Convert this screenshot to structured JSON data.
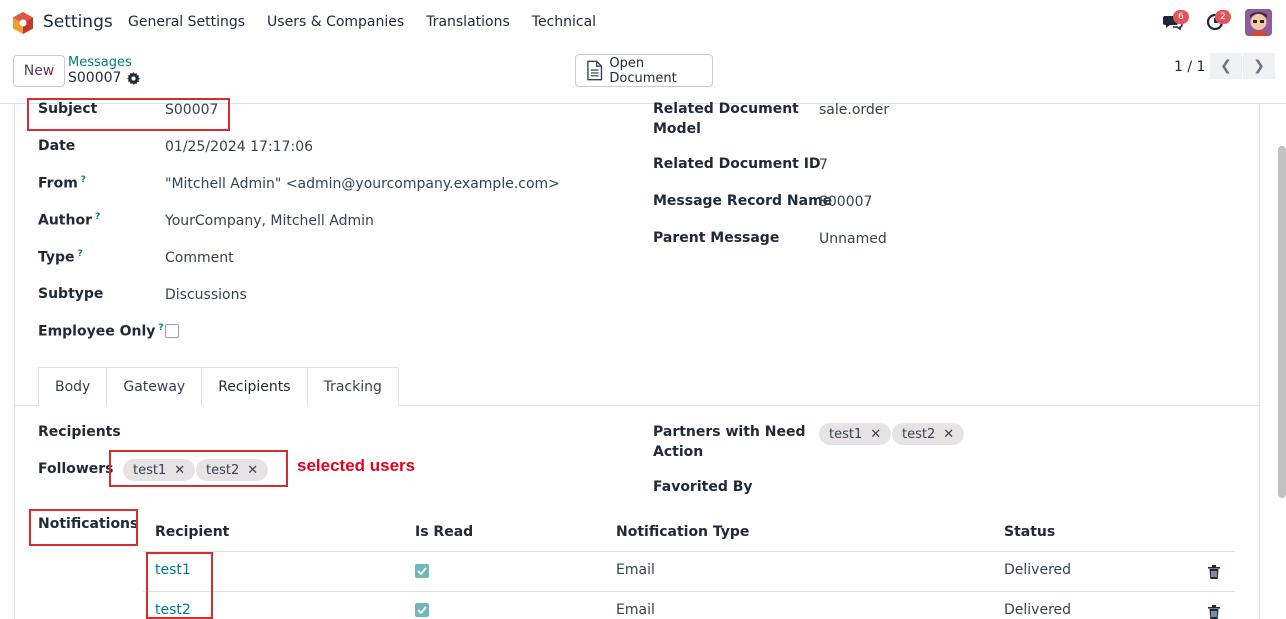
{
  "nav": {
    "app_title": "Settings",
    "menu": [
      "General Settings",
      "Users & Companies",
      "Translations",
      "Technical"
    ],
    "messages_badge": "6",
    "activity_badge": "2"
  },
  "control": {
    "new_label": "New",
    "breadcrumb": "Messages",
    "record_name": "S00007",
    "open_document_label": "Open Document",
    "pager": "1 / 1"
  },
  "fields_left": [
    {
      "label": "Subject",
      "value": "S00007",
      "help": false
    },
    {
      "label": "Date",
      "value": "01/25/2024 17:17:06",
      "help": false
    },
    {
      "label": "From",
      "value": "\"Mitchell Admin\" <admin@yourcompany.example.com>",
      "help": true
    },
    {
      "label": "Author",
      "value": "YourCompany, Mitchell Admin",
      "help": true
    },
    {
      "label": "Type",
      "value": "Comment",
      "help": true
    },
    {
      "label": "Subtype",
      "value": "Discussions",
      "help": false
    },
    {
      "label": "Employee Only",
      "value": "",
      "help": true
    }
  ],
  "fields_right": {
    "related_model_label_1": "Related Document",
    "related_model_label_2": "Model",
    "related_model_value": "sale.order",
    "related_id_label": "Related Document ID",
    "related_id_value": "7",
    "record_name_label": "Message Record Name",
    "record_name_value": "S00007",
    "parent_label": "Parent Message",
    "parent_value": "Unnamed"
  },
  "tabs": [
    "Body",
    "Gateway",
    "Recipients",
    "Tracking"
  ],
  "recipients_tab": {
    "recipients_label": "Recipients",
    "followers_label": "Followers",
    "followers": [
      "test1",
      "test2"
    ],
    "annotation": "selected users",
    "partners_label_1": "Partners with Need",
    "partners_label_2": "Action",
    "partners": [
      "test1",
      "test2"
    ],
    "favorited_label": "Favorited By",
    "notifications_label": "Notifications"
  },
  "table": {
    "headers": [
      "Recipient",
      "Is Read",
      "Notification Type",
      "Status"
    ],
    "rows": [
      {
        "recipient": "test1",
        "is_read": true,
        "type": "Email",
        "status": "Delivered"
      },
      {
        "recipient": "test2",
        "is_read": true,
        "type": "Email",
        "status": "Delivered"
      }
    ]
  },
  "colors": {
    "accent": "#017e84",
    "brand": "#714b67",
    "annotation_red": "#e3001b"
  },
  "help_mark": "?",
  "close_glyph": "✕"
}
